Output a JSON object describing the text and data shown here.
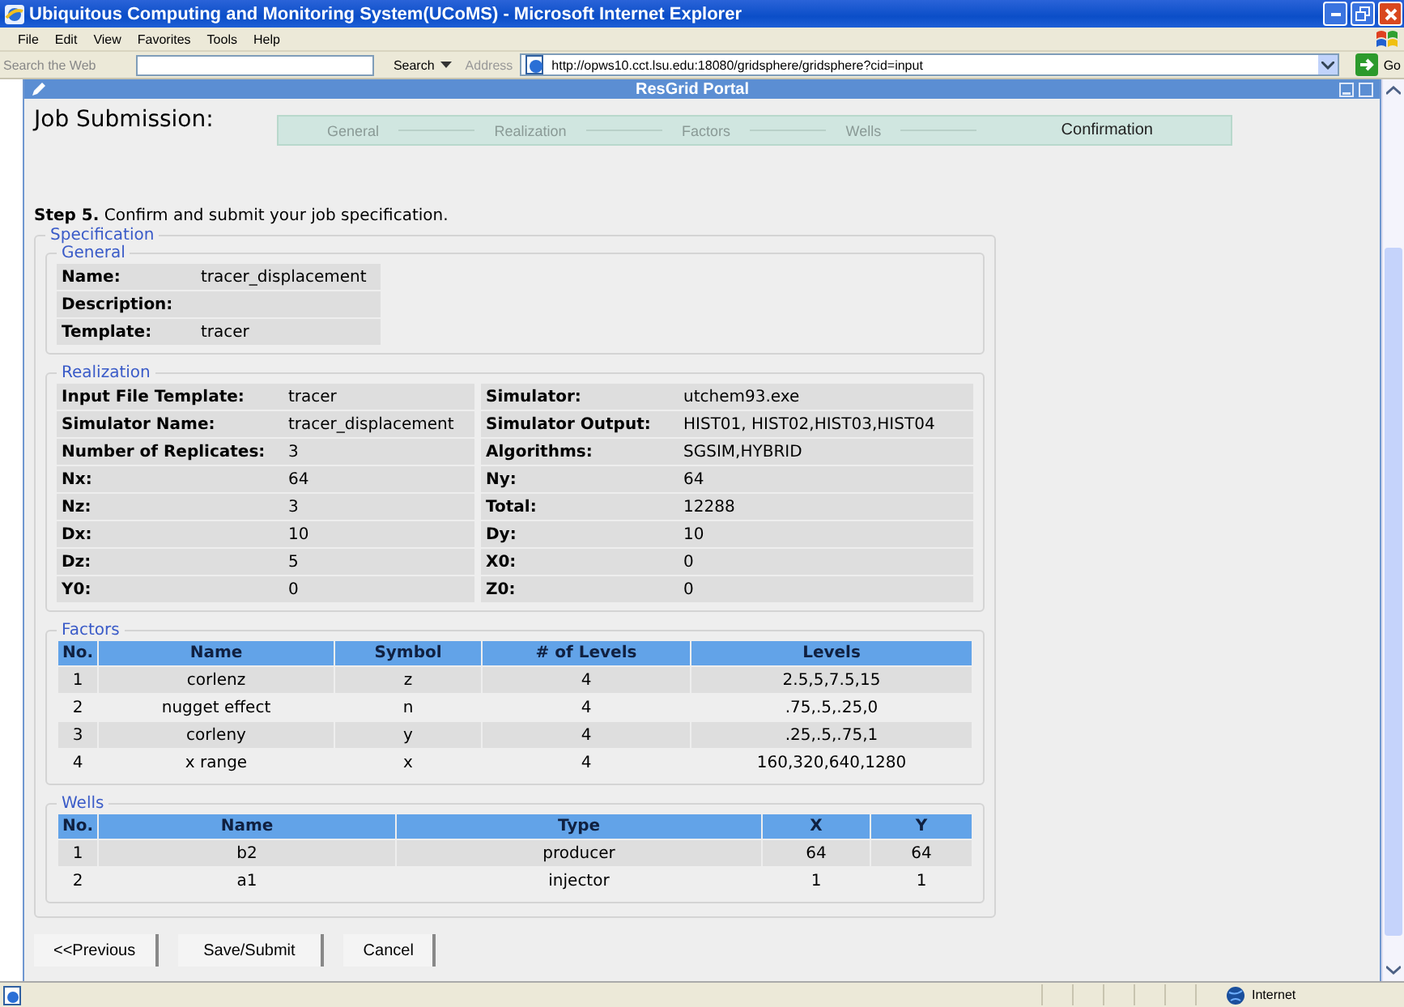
{
  "window": {
    "title": "Ubiquitous Computing and Monitoring System(UCoMS) - Microsoft Internet Explorer"
  },
  "menu": [
    "File",
    "Edit",
    "View",
    "Favorites",
    "Tools",
    "Help"
  ],
  "toolbar": {
    "search": {
      "placeholder": "Search the Web"
    },
    "search_button": "Search",
    "address_label": "Address",
    "address": "http://opws10.cct.lsu.edu:18080/gridsphere/gridsphere?cid=input",
    "go": "Go"
  },
  "portal": {
    "title": "ResGrid Portal"
  },
  "page": {
    "heading": "Job Submission:",
    "steps": [
      {
        "label": "General",
        "selected": false
      },
      {
        "label": "Realization",
        "selected": false
      },
      {
        "label": "Factors",
        "selected": false
      },
      {
        "label": "Wells",
        "selected": false
      },
      {
        "label": "Confirmation",
        "selected": true
      }
    ],
    "instruction": "**Step 5.** Confirm and submit your job specification.",
    "specification": {
      "legend": "Specification",
      "general": {
        "legend": "General",
        "rows": [
          {
            "label": "Name:",
            "value": "tracer_displacement"
          },
          {
            "label": "Description:",
            "value": ""
          },
          {
            "label": "Template:",
            "value": "tracer"
          }
        ]
      },
      "realization": {
        "legend": "Realization",
        "rows": [
          [
            "Input File Template:",
            "tracer",
            "Simulator:",
            "utchem93.exe"
          ],
          [
            "Simulator Name:",
            "tracer_displacement",
            "Simulator Output:",
            "HIST01, HIST02,HIST03,HIST04"
          ],
          [
            "Number of Replicates:",
            "3",
            "Algorithms:",
            "SGSIM,HYBRID"
          ],
          [
            "Nx:",
            "64",
            "Ny:",
            "64"
          ],
          [
            "Nz:",
            "3",
            "Total:",
            "12288"
          ],
          [
            "Dx:",
            "10",
            "Dy:",
            "10"
          ],
          [
            "Dz:",
            "5",
            "X0:",
            "0"
          ],
          [
            "Y0:",
            "0",
            "Z0:",
            "0"
          ]
        ]
      },
      "factors": {
        "legend": "Factors",
        "columns": [
          "No.",
          "Name",
          "Symbol",
          "# of Levels",
          "Levels"
        ],
        "rows": [
          [
            "1",
            "corlenz",
            "z",
            "4",
            "2.5,5,7.5,15"
          ],
          [
            "2",
            "nugget effect",
            "n",
            "4",
            ".75,.5,.25,0"
          ],
          [
            "3",
            "corleny",
            "y",
            "4",
            ".25,.5,.75,1"
          ],
          [
            "4",
            "x range",
            "x",
            "4",
            "160,320,640,1280"
          ]
        ]
      },
      "wells": {
        "legend": "Wells",
        "columns": [
          "No.",
          "Name",
          "Type",
          "X",
          "Y"
        ],
        "rows": [
          [
            "1",
            "b2",
            "producer",
            "64",
            "64"
          ],
          [
            "2",
            "a1",
            "injector",
            "1",
            "1"
          ]
        ]
      }
    },
    "buttons": [
      "<<Previous",
      "Save/Submit",
      "Cancel"
    ]
  },
  "status_bar": {
    "zone": "Internet"
  }
}
